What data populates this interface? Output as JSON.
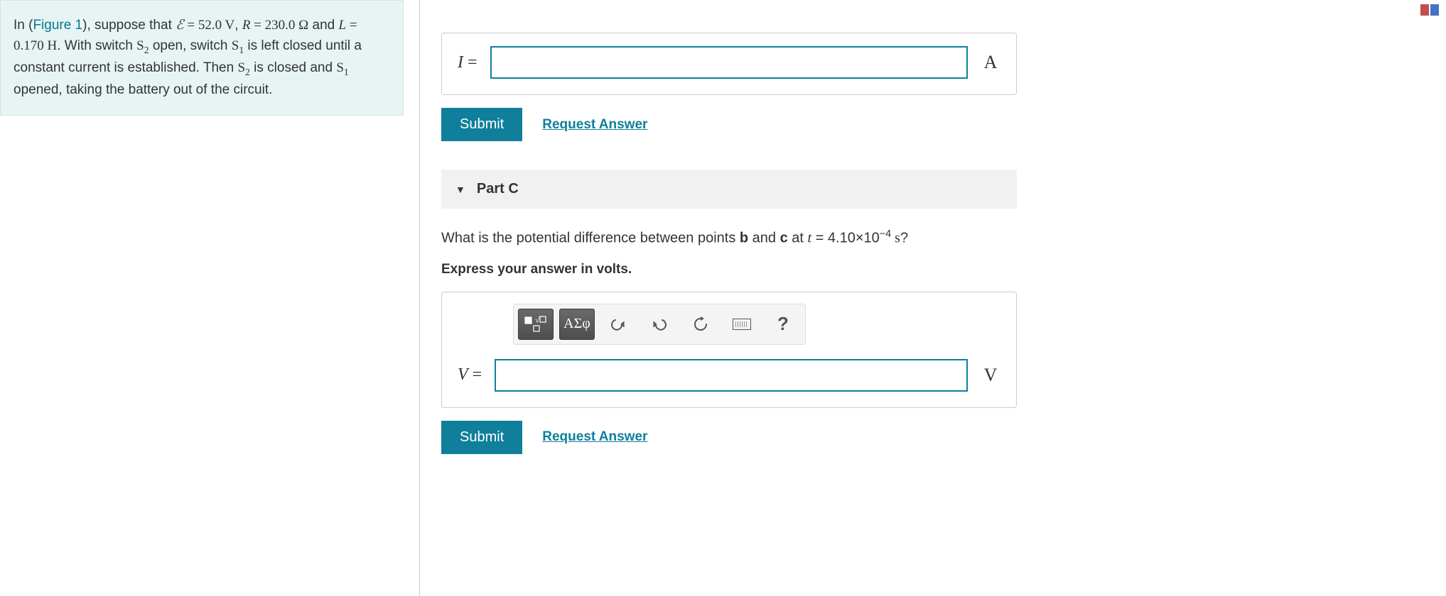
{
  "problem": {
    "prefix": "In (",
    "figure_link": "Figure 1",
    "after_link": "), suppose that ",
    "emf_sym": "ℰ",
    "eq": " = ",
    "emf_val": "52.0",
    "volt": " V",
    "comma1": ", ",
    "R_sym": "R",
    "R_val": "230.0",
    "ohm": " Ω",
    "and": " and ",
    "L_sym": "L",
    "L_val": "0.170",
    "henry": " H",
    "sentence2a": ". With switch ",
    "S2": "S",
    "sub2": "2",
    "s2_open": " open, switch ",
    "S1": "S",
    "sub1": "1",
    "s1_left": " is left closed until a constant current is established. Then ",
    "s2_closed": " is closed and ",
    "s1_opened": " opened, taking the battery out of the circuit."
  },
  "partB": {
    "var": "I",
    "eq": " = ",
    "unit": "A",
    "submit": "Submit",
    "request": "Request Answer"
  },
  "partC": {
    "header": "Part C",
    "q_before": "What is the potential difference between points ",
    "b": "b",
    "and": " and ",
    "c": "c",
    "at": " at ",
    "t": "t",
    "eq": " = ",
    "t_val": "4.10×10",
    "t_exp": "−4",
    "s_unit": " s",
    "qmark": "?",
    "instruct": "Express your answer in volts.",
    "greek_label": "ΑΣφ",
    "var": "V",
    "var_eq": " = ",
    "unit": "V",
    "submit": "Submit",
    "request": "Request Answer"
  }
}
